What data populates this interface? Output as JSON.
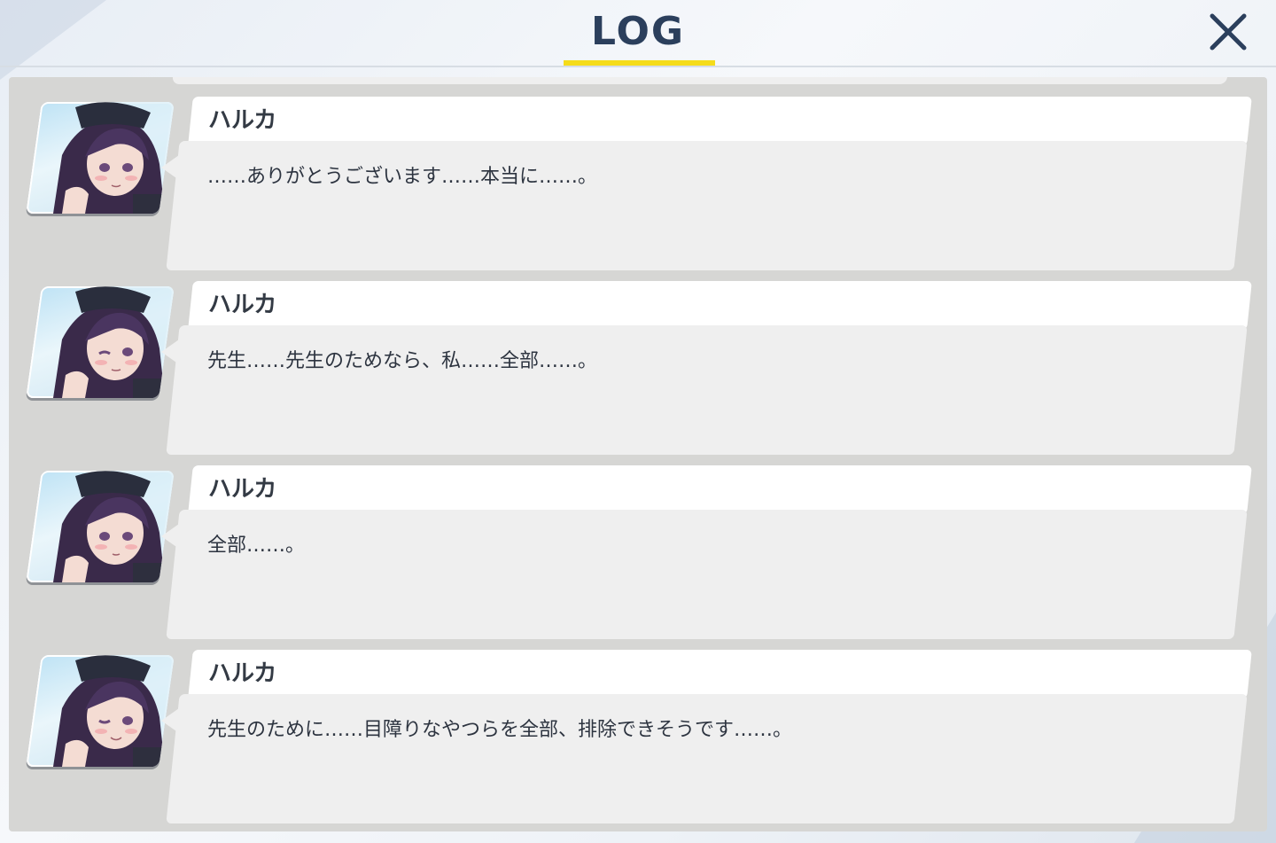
{
  "header": {
    "title": "LOG",
    "close_icon": "close-icon"
  },
  "colors": {
    "title": "#2b3f5c",
    "underline": "#f5dc1a",
    "panel": "#d6d6d4",
    "bubble": "#efefef",
    "name_bar": "#ffffff"
  },
  "entries": [
    {
      "speaker": "ハルカ",
      "text": "……ありがとうございます……本当に……。",
      "avatar_icon": "character-portrait-icon"
    },
    {
      "speaker": "ハルカ",
      "text": "先生……先生のためなら、私……全部……。",
      "avatar_icon": "character-portrait-icon"
    },
    {
      "speaker": "ハルカ",
      "text": "全部……。",
      "avatar_icon": "character-portrait-icon"
    },
    {
      "speaker": "ハルカ",
      "text": "先生のために……目障りなやつらを全部、排除できそうです……。",
      "avatar_icon": "character-portrait-icon"
    }
  ]
}
